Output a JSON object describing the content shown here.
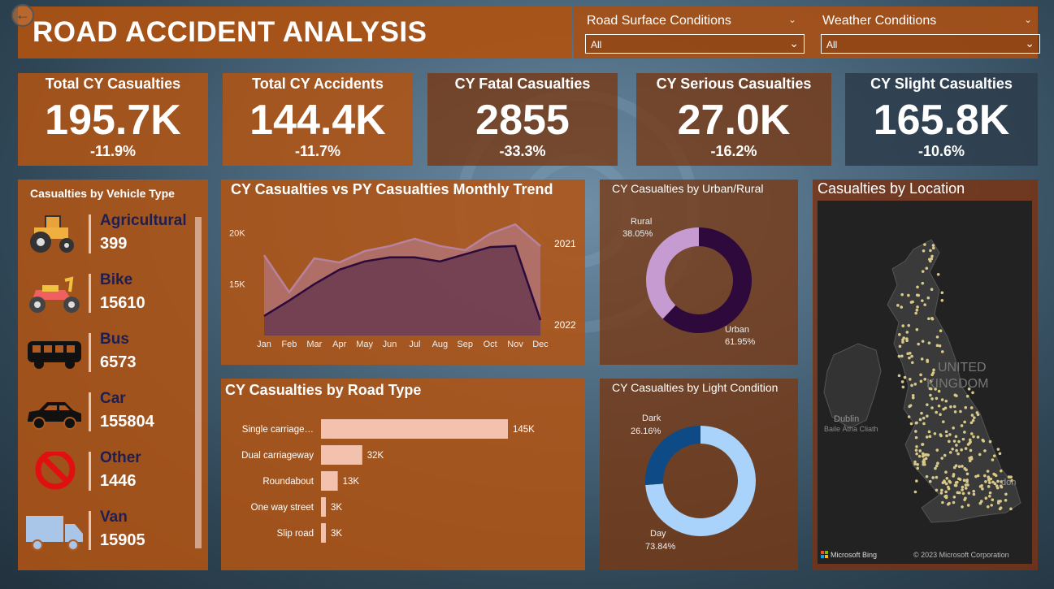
{
  "header": {
    "title": "ROAD ACCIDENT ANALYSIS",
    "back_icon": "back-arrow-icon"
  },
  "filters": [
    {
      "label": "Road Surface Conditions",
      "value": "All"
    },
    {
      "label": "Weather Conditions",
      "value": "All"
    }
  ],
  "kpis": [
    {
      "label": "Total CY Casualties",
      "value": "195.7K",
      "change": "-11.9%"
    },
    {
      "label": "Total CY Accidents",
      "value": "144.4K",
      "change": "-11.7%"
    },
    {
      "label": "CY Fatal Casualties",
      "value": "2855",
      "change": "-33.3%"
    },
    {
      "label": "CY Serious Casualties",
      "value": "27.0K",
      "change": "-16.2%"
    },
    {
      "label": "CY Slight Casualties",
      "value": "165.8K",
      "change": "-10.6%"
    }
  ],
  "vehicle": {
    "title": "Casualties by Vehicle Type",
    "items": [
      {
        "name": "Agricultural",
        "count": "399",
        "icon": "tractor-icon"
      },
      {
        "name": "Bike",
        "count": "15610",
        "icon": "motorbike-icon"
      },
      {
        "name": "Bus",
        "count": "6573",
        "icon": "bus-icon"
      },
      {
        "name": "Car",
        "count": "155804",
        "icon": "car-icon"
      },
      {
        "name": "Other",
        "count": "1446",
        "icon": "no-entry-icon"
      },
      {
        "name": "Van",
        "count": "15905",
        "icon": "van-icon"
      }
    ]
  },
  "trend": {
    "title": "CY Casualties vs PY Casualties Monthly Trend"
  },
  "road": {
    "title": "CY Casualties by Road Type"
  },
  "urban": {
    "title": "CY Casualties by Urban/Rural"
  },
  "light": {
    "title": "CY Casualties by Light Condition"
  },
  "map": {
    "title": "Casualties by Location",
    "country_label": [
      "UNITED",
      "KINGDOM"
    ],
    "place_labels": [
      "Dublin",
      "Baile Átha Cliath",
      "don"
    ],
    "bing_label": "Microsoft Bing",
    "copyright": "© 2023 Microsoft Corporation"
  },
  "chart_data": [
    {
      "type": "area",
      "title": "CY Casualties vs PY Casualties Monthly Trend",
      "categories": [
        "Jan",
        "Feb",
        "Mar",
        "Apr",
        "May",
        "Jun",
        "Jul",
        "Aug",
        "Sep",
        "Oct",
        "Nov",
        "Dec"
      ],
      "yticks": [
        15000,
        20000
      ],
      "ytick_labels": [
        "15K",
        "20K"
      ],
      "ylim": [
        10000,
        22000
      ],
      "series": [
        {
          "name": "2021",
          "values": [
            17800,
            14200,
            17500,
            17100,
            18200,
            18700,
            19400,
            18700,
            18300,
            19900,
            20800,
            18700
          ],
          "color": "#b8829e"
        },
        {
          "name": "2022",
          "values": [
            11900,
            13400,
            15000,
            16400,
            17200,
            17600,
            17600,
            17200,
            17900,
            18600,
            18700,
            11500
          ],
          "color": "#2c0a3c"
        }
      ]
    },
    {
      "type": "bar",
      "title": "CY Casualties by Road Type",
      "categories": [
        "Single carriage…",
        "Dual carriageway",
        "Roundabout",
        "One way street",
        "Slip road"
      ],
      "values": [
        145000,
        32000,
        13000,
        3000,
        3000
      ],
      "labels": [
        "145K",
        "32K",
        "13K",
        "3K",
        "3K"
      ],
      "color": "#f3c2ae"
    },
    {
      "type": "pie",
      "title": "CY Casualties by Urban/Rural",
      "slices": [
        {
          "name": "Rural",
          "value": 38.05,
          "label": "38.05%",
          "color": "#c59bd1"
        },
        {
          "name": "Urban",
          "value": 61.95,
          "label": "61.95%",
          "color": "#2e0a3c"
        }
      ]
    },
    {
      "type": "pie",
      "title": "CY Casualties by Light Condition",
      "slices": [
        {
          "name": "Dark",
          "value": 26.16,
          "label": "26.16%",
          "color": "#0e4a85"
        },
        {
          "name": "Day",
          "value": 73.84,
          "label": "73.84%",
          "color": "#a9d3fb"
        }
      ]
    }
  ]
}
